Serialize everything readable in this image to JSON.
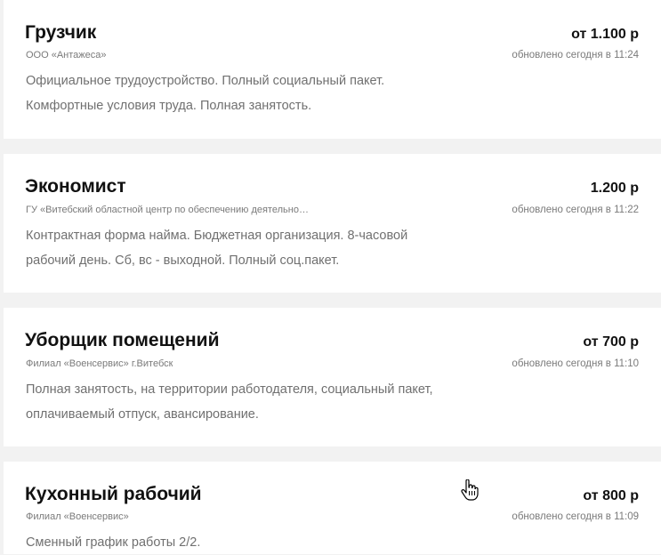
{
  "vacancies": [
    {
      "title": "Грузчик",
      "salary": "от 1.100 р",
      "company": "ООО «Антажеса»",
      "updated": "обновлено сегодня в 11:24",
      "description": "Официальное трудоустройство. Полный социальный пакет. Комфортные условия труда. Полная занятость."
    },
    {
      "title": "Экономист",
      "salary": "1.200 р",
      "company": "ГУ «Витебский областной центр по обеспечению деятельно…",
      "updated": "обновлено сегодня в 11:22",
      "description": "Контрактная форма найма. Бюджетная организация. 8-часовой рабочий день. Сб, вс - выходной. Полный соц.пакет."
    },
    {
      "title": "Уборщик помещений",
      "salary": "от 700 р",
      "company": "Филиал «Военсервис» г.Витебск",
      "updated": "обновлено сегодня в 11:10",
      "description": "Полная занятость, на территории работодателя, социальный пакет, оплачиваемый отпуск, авансирование."
    },
    {
      "title": "Кухонный рабочий",
      "salary": "от 800 р",
      "company": "Филиал «Военсервис»",
      "updated": "обновлено сегодня в 11:09",
      "description": "Сменный график работы 2/2."
    }
  ],
  "cursor_icon": "hand-pointer-icon"
}
